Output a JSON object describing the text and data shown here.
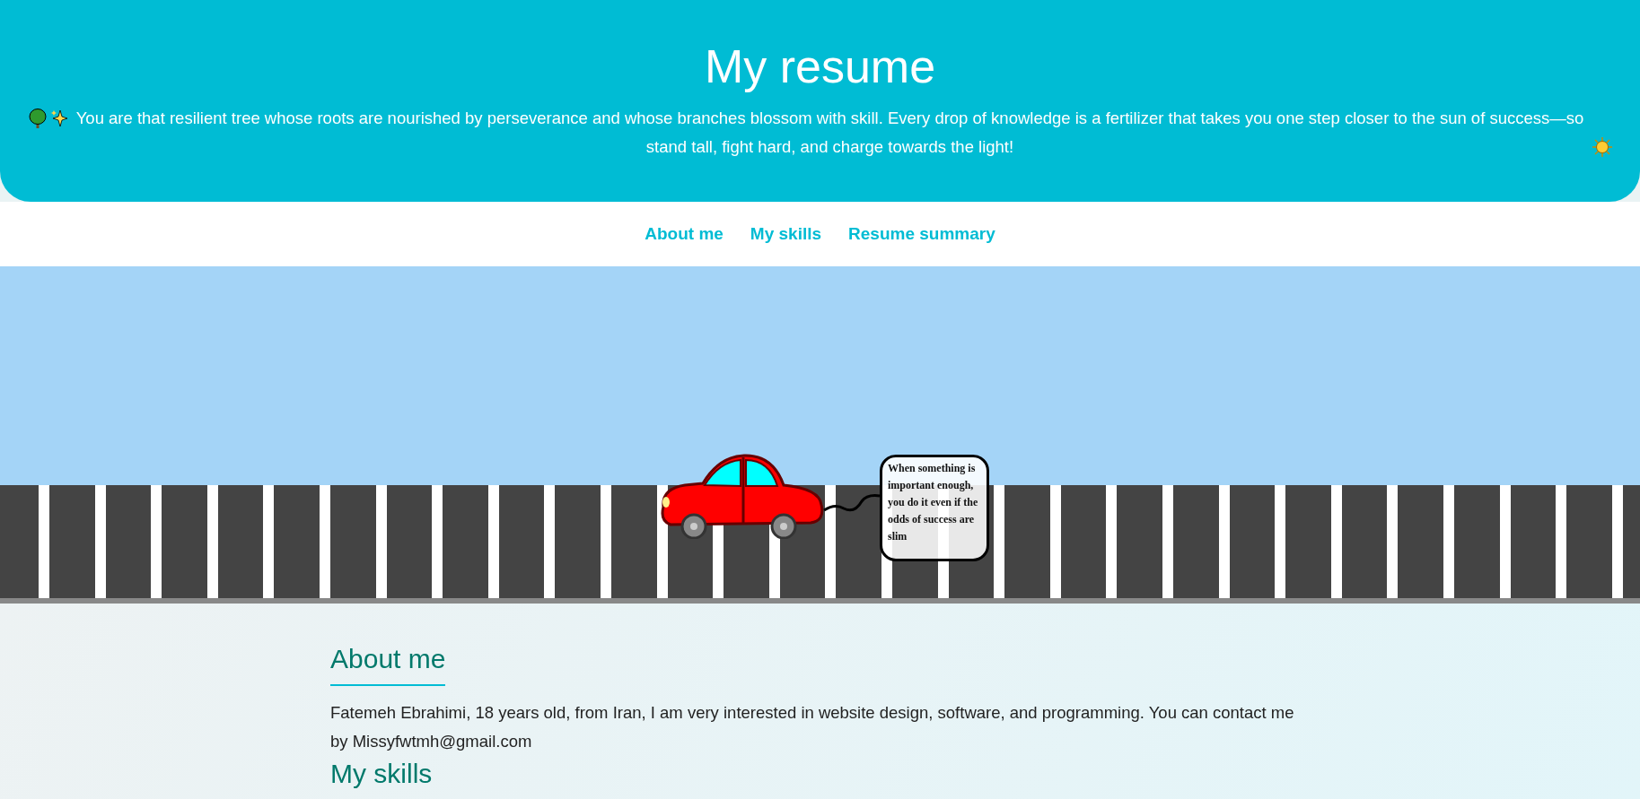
{
  "header": {
    "title": "My resume",
    "quote": "You are that resilient tree whose roots are nourished by perseverance and whose branches blossom with skill. Every drop of knowledge is a fertilizer that takes you one step closer to the sun of success—so stand tall, fight hard, and charge towards the light!"
  },
  "nav": {
    "links": [
      {
        "label": "About me"
      },
      {
        "label": "My skills"
      },
      {
        "label": "Resume summary"
      }
    ]
  },
  "scene": {
    "bubble_text": "When something is important enough, you do it even if the odds of success are slim"
  },
  "sections": [
    {
      "heading": "About me",
      "body": "Fatemeh Ebrahimi, 18 years old, from Iran, I am very interested in website design, software, and programming. You can contact me by Missyfwtmh@gmail.com"
    },
    {
      "heading": "My skills"
    }
  ]
}
